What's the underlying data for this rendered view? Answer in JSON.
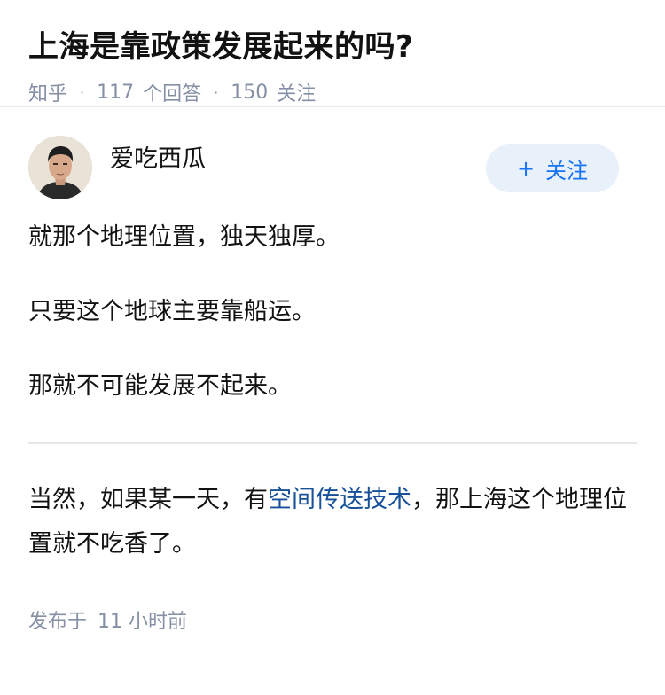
{
  "question": {
    "title": "上海是靠政策发展起来的吗?",
    "source": "知乎",
    "answer_count": "117",
    "answer_label": "个回答",
    "follower_count": "150",
    "follower_label": "关注"
  },
  "author": {
    "name": "爱吃西瓜",
    "avatar": "avatar-portrait",
    "follow_plus": "+",
    "follow_label": "关注"
  },
  "content": {
    "p1": "就那个地理位置，独天独厚。",
    "p2": "只要这个地球主要靠船运。",
    "p3": "那就不可能发展不起来。",
    "p4_before": "当然，如果某一天，有",
    "p4_link": "空间传送技术",
    "p4_after": "，那上海这个地理位置就不吃香了。"
  },
  "footer": {
    "published_label": "发布于",
    "published_time": "11 小时前"
  },
  "colors": {
    "accent": "#1772f6",
    "link": "#175199",
    "meta_text": "#8590a6",
    "follow_bg": "#e8f0fa"
  }
}
